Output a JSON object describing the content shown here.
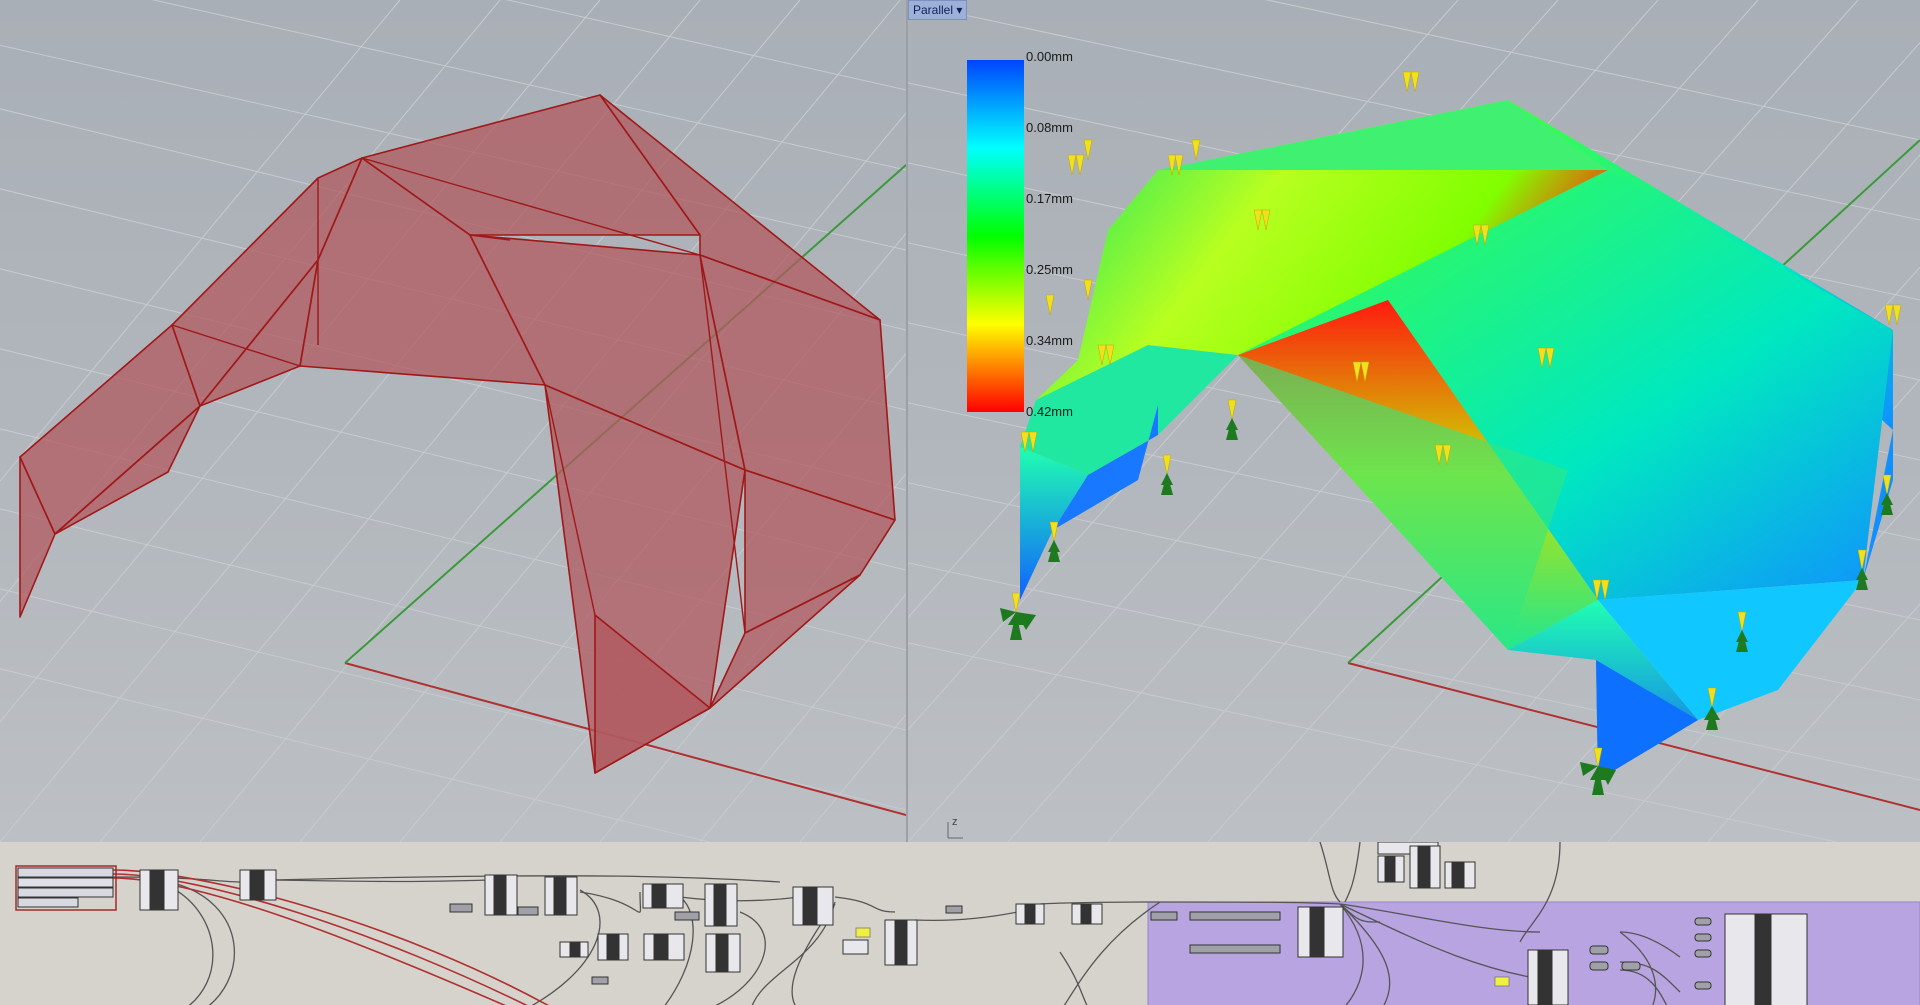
{
  "right_viewport": {
    "projection_label": "Parallel",
    "projection_dropdown_icon": "chevron-down-icon",
    "axis_label": "z"
  },
  "legend": {
    "labels": [
      "0.00mm",
      "0.08mm",
      "0.17mm",
      "0.25mm",
      "0.34mm",
      "0.42mm"
    ],
    "colors": [
      "#0000ff",
      "#00ffff",
      "#00ff00",
      "#ffff00",
      "#ff0000"
    ]
  },
  "colors": {
    "viewport_background": "#b0b5bb",
    "grid_line": "#c8ccd0",
    "shell_fill": "#b05a5f",
    "shell_edge": "#a01818",
    "x_axis": "#b03030",
    "y_axis": "#3a9a3a",
    "load_marker": "#f0e020",
    "support_marker": "#1e7a1e",
    "canvas_background": "#d6d3cc",
    "cluster_background": "#b7a4e0"
  }
}
